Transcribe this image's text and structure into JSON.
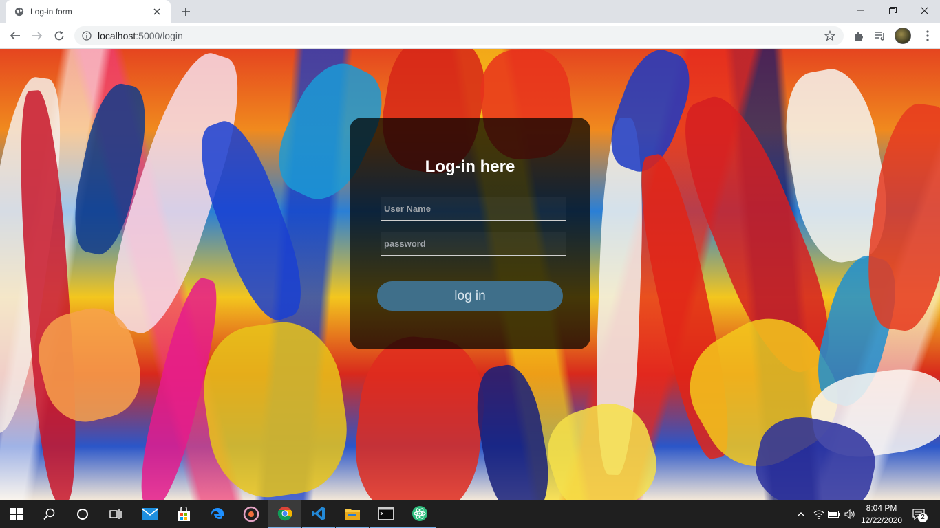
{
  "browser": {
    "tab_title": "Log-in form",
    "url_host": "localhost",
    "url_path": ":5000/login"
  },
  "form": {
    "heading": "Log-in here",
    "username_placeholder": "User Name",
    "password_placeholder": "password",
    "login_label": "log in"
  },
  "taskbar": {
    "time": "8:04 PM",
    "date": "12/22/2020",
    "notification_count": "2"
  },
  "colors": {
    "card_bg": "#000000b8",
    "button_bg": "#3f6f8a",
    "taskbar_bg": "#1f1f1f"
  }
}
